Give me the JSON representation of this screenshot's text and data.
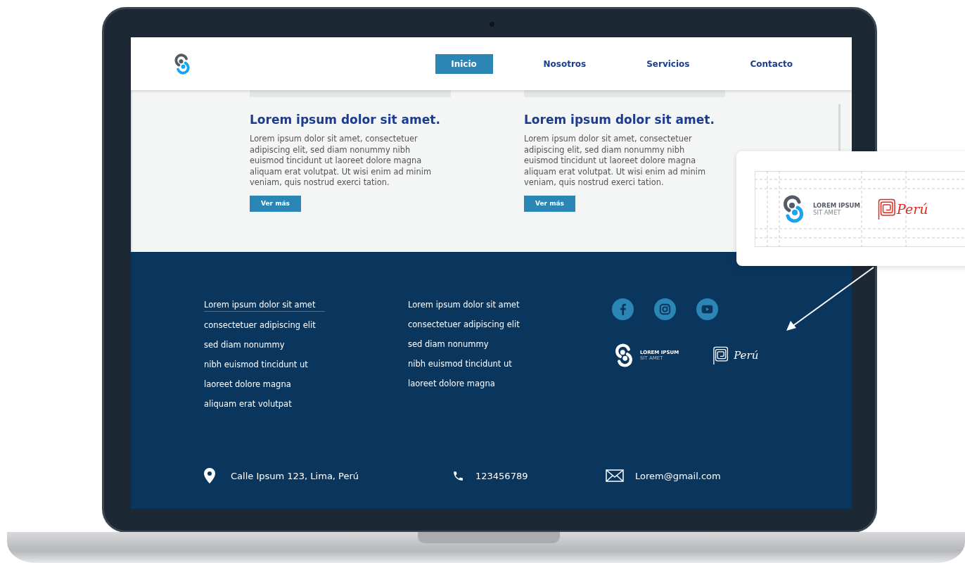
{
  "nav": {
    "items": [
      {
        "label": "Inicio",
        "selected": true
      },
      {
        "label": "Nosotros",
        "selected": false
      },
      {
        "label": "Servicios",
        "selected": false
      },
      {
        "label": "Contacto",
        "selected": false
      }
    ]
  },
  "cards": [
    {
      "title": "Lorem ipsum dolor sit amet.",
      "body": "Lorem ipsum dolor sit amet, consectetuer adipiscing elit, sed diam nonummy nibh euismod tincidunt ut laoreet dolore magna aliquam erat volutpat. Ut wisi enim ad minim veniam, quis nostrud exerci tation.",
      "button": "Ver más"
    },
    {
      "title": "Lorem ipsum dolor sit amet.",
      "body": "Lorem ipsum dolor sit amet, consectetuer adipiscing elit, sed diam nonummy nibh euismod tincidunt ut laoreet dolore magna aliquam erat volutpat. Ut wisi enim ad minim veniam, quis nostrud exerci tation.",
      "button": "Ver más"
    }
  ],
  "footer": {
    "link_columns": [
      {
        "links": [
          {
            "label": "Lorem ipsum dolor sit amet",
            "selected": true
          },
          {
            "label": "consectetuer adipiscing elit",
            "selected": false
          },
          {
            "label": "sed diam nonummy",
            "selected": false
          },
          {
            "label": "nibh euismod tincidunt ut",
            "selected": false
          },
          {
            "label": "laoreet dolore magna",
            "selected": false
          },
          {
            "label": "aliquam erat volutpat",
            "selected": false
          }
        ]
      },
      {
        "links": [
          {
            "label": "Lorem ipsum dolor sit amet",
            "selected": false
          },
          {
            "label": "consectetuer adipiscing elit",
            "selected": false
          },
          {
            "label": "sed diam nonummy",
            "selected": false
          },
          {
            "label": "nibh euismod tincidunt ut",
            "selected": false
          },
          {
            "label": "laoreet dolore magna",
            "selected": false
          }
        ]
      }
    ],
    "social": [
      {
        "kind": "facebook"
      },
      {
        "kind": "instagram"
      },
      {
        "kind": "youtube"
      }
    ],
    "brand": {
      "name": "LOREM IPSUM",
      "tagline": "SIT AMET",
      "partner": "Perú"
    },
    "contacts": [
      {
        "kind": "location",
        "text": "Calle Ipsum 123, Lima, Perú"
      },
      {
        "kind": "phone",
        "text": "123456789"
      },
      {
        "kind": "email",
        "text": "Lorem@gmail.com"
      }
    ]
  },
  "callout": {
    "brand": {
      "name": "LOREM IPSUM",
      "tagline": "SIT AMET",
      "partner": "Perú"
    }
  }
}
